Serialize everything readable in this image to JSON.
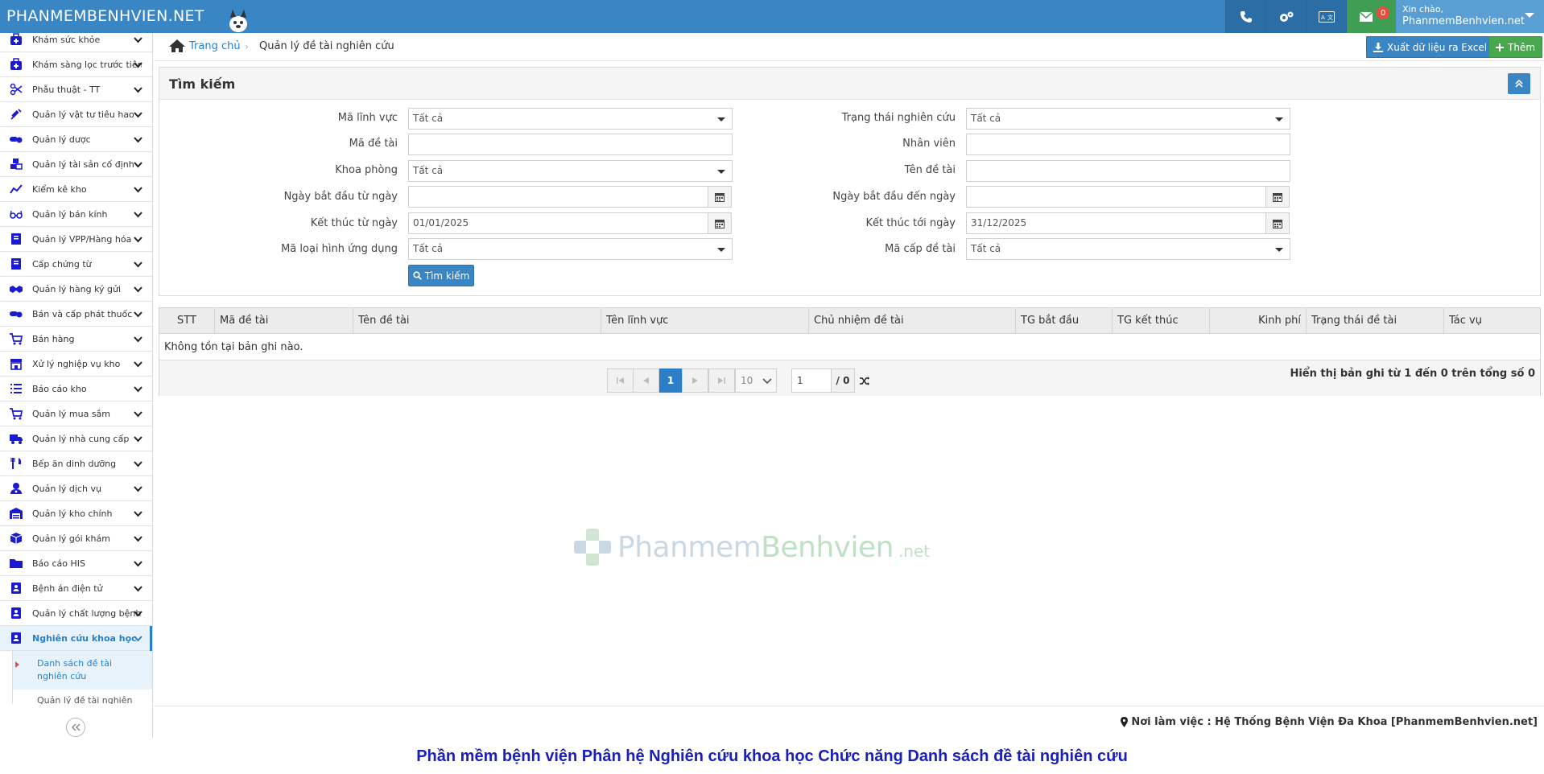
{
  "brand": "PHANMEMBENHVIEN.NET",
  "header": {
    "mail_count": "0",
    "greeting": "Xin chào,",
    "username": "PhanmemBenhvien.net"
  },
  "sidebar": {
    "items": [
      {
        "label": "Khám sức khỏe",
        "icon": "medkit-icon"
      },
      {
        "label": "Khám sàng lọc trước tiêm",
        "icon": "medkit-icon"
      },
      {
        "label": "Phẫu thuật - TT",
        "icon": "scissors-icon"
      },
      {
        "label": "Quản lý vật tư tiêu hao",
        "icon": "syringe-icon"
      },
      {
        "label": "Quản lý dược",
        "icon": "pills-icon"
      },
      {
        "label": "Quản lý tài sản cố định",
        "icon": "cubes-icon"
      },
      {
        "label": "Kiểm kê kho",
        "icon": "chart-icon"
      },
      {
        "label": "Quản lý bán kính",
        "icon": "glasses-icon"
      },
      {
        "label": "Quản lý VPP/Hàng hóa",
        "icon": "book-icon"
      },
      {
        "label": "Cấp chứng từ",
        "icon": "book-icon"
      },
      {
        "label": "Quản lý hàng ký gửi",
        "icon": "handshake-icon"
      },
      {
        "label": "Bán và cấp phát thuốc",
        "icon": "pills-icon"
      },
      {
        "label": "Bán hàng",
        "icon": "cart-icon"
      },
      {
        "label": "Xử lý nghiệp vụ kho",
        "icon": "store-icon"
      },
      {
        "label": "Báo cáo kho",
        "icon": "list-icon"
      },
      {
        "label": "Quản lý mua sắm",
        "icon": "cart-icon"
      },
      {
        "label": "Quản lý nhà cung cấp",
        "icon": "truck-icon"
      },
      {
        "label": "Bếp ăn dinh dưỡng",
        "icon": "utensils-icon"
      },
      {
        "label": "Quản lý dịch vụ",
        "icon": "user-md-icon"
      },
      {
        "label": "Quản lý kho chính",
        "icon": "warehouse-icon"
      },
      {
        "label": "Quản lý gói khám",
        "icon": "box-icon"
      },
      {
        "label": "Báo cáo HIS",
        "icon": "folder-icon"
      },
      {
        "label": "Bệnh án điện tử",
        "icon": "id-card-icon"
      },
      {
        "label": "Quản lý chất lượng bệnh viện",
        "icon": "id-card-icon"
      },
      {
        "label": "Nghiên cứu khoa học",
        "icon": "id-card-icon"
      }
    ],
    "sub_items": [
      {
        "label": "Danh sách đề tài nghiên cứu"
      },
      {
        "label": "Quản lý đề tài nghiên cứu"
      }
    ]
  },
  "breadcrumb": {
    "home": "Trang chủ",
    "current": "Quản lý đề tài nghiên cứu"
  },
  "toolbar": {
    "excel_label": "Xuất dữ liệu ra Excel",
    "add_label": "Thêm"
  },
  "search": {
    "title": "Tìm kiếm",
    "fields": {
      "ma_linh_vuc": {
        "label": "Mã lĩnh vực",
        "value": "Tất cả"
      },
      "ma_de_tai": {
        "label": "Mã đề tài",
        "value": ""
      },
      "khoa_phong": {
        "label": "Khoa phòng",
        "value": "Tất cả"
      },
      "ngay_bd_tu": {
        "label": "Ngày bắt đầu từ ngày",
        "value": ""
      },
      "ket_thuc_tu": {
        "label": "Kết thúc từ ngày",
        "value": "01/01/2025"
      },
      "ma_loai_hinh": {
        "label": "Mã loại hình ứng dụng",
        "value": "Tất cả"
      },
      "trang_thai": {
        "label": "Trạng thái nghiên cứu",
        "value": "Tất cả"
      },
      "nhan_vien": {
        "label": "Nhân viên",
        "value": ""
      },
      "ten_de_tai": {
        "label": "Tên đề tài",
        "value": ""
      },
      "ngay_bd_den": {
        "label": "Ngày bắt đầu đến ngày",
        "value": ""
      },
      "ket_thuc_toi": {
        "label": "Kết thúc tới ngày",
        "value": "31/12/2025"
      },
      "ma_cap": {
        "label": "Mã cấp đề tài",
        "value": "Tất cả"
      }
    },
    "button": "Tìm kiếm"
  },
  "table": {
    "columns": [
      "STT",
      "Mã đề tài",
      "Tên đề tài",
      "Tên lĩnh vực",
      "Chủ nhiệm đề tài",
      "TG bắt đầu",
      "TG kết thúc",
      "Kinh phí",
      "Trạng thái đề tài",
      "Tác vụ"
    ],
    "empty_text": "Không tồn tại bản ghi nào.",
    "pager": {
      "page": "1",
      "page_size": "10",
      "goto": "1",
      "total_pages": "/ 0",
      "info": "Hiển thị bản ghi từ 1 đến 0 trên tổng số 0"
    }
  },
  "watermark": {
    "part1": "Phanmem",
    "part2": "Benhvien",
    "suffix": ".net"
  },
  "footer": {
    "workplace": "Nơi làm việc : Hệ Thống Bệnh Viện Đa Khoa [PhanmemBenhvien.net]"
  },
  "caption": "Phần mềm bệnh viện Phân hệ Nghiên cứu khoa học Chức năng Danh sách đề tài nghiên cứu",
  "colors": {
    "primary": "#3a85c4",
    "success": "#48a84e",
    "sidebar_icon": "#1a1ad1",
    "caption": "#1a20b8"
  }
}
